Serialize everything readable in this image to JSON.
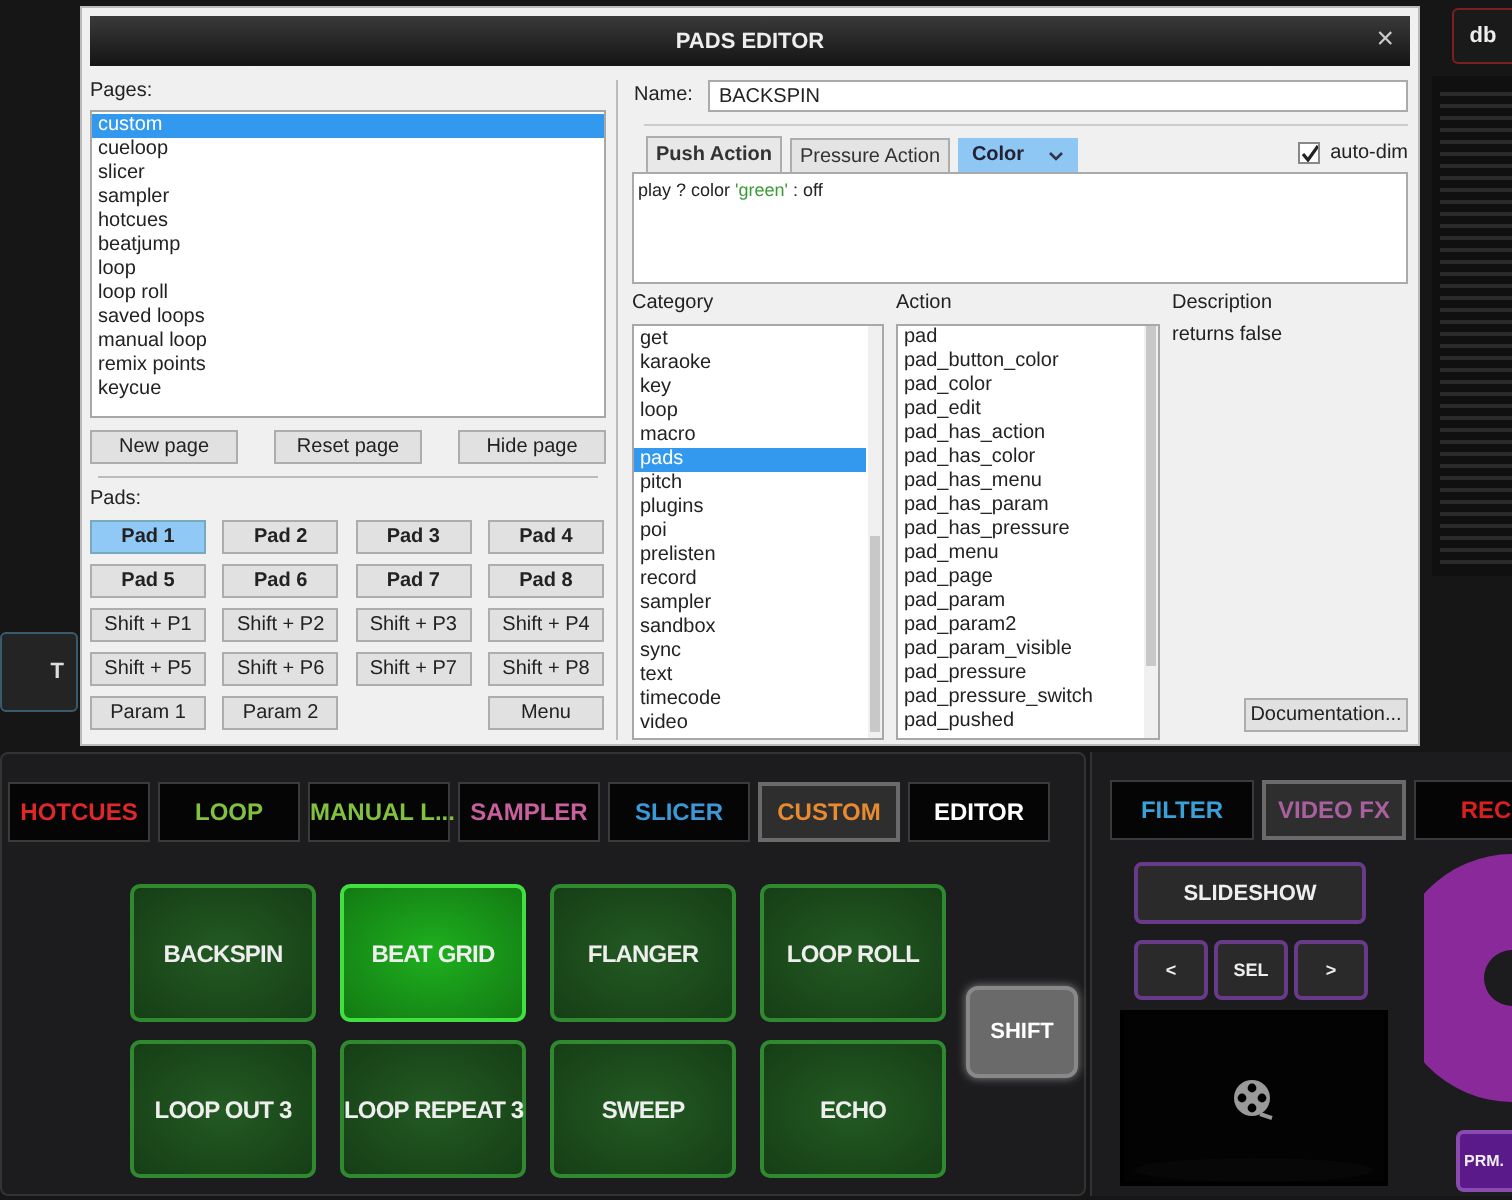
{
  "background": {
    "side_button": "T",
    "level_button": "db"
  },
  "dialog": {
    "title": "PADS EDITOR",
    "close": "×",
    "pages": {
      "label": "Pages:",
      "items": [
        {
          "label": "custom",
          "selected": true
        },
        {
          "label": "cueloop",
          "selected": false
        },
        {
          "label": "slicer",
          "selected": false
        },
        {
          "label": "sampler",
          "selected": false
        },
        {
          "label": "hotcues",
          "selected": false
        },
        {
          "label": "beatjump",
          "selected": false
        },
        {
          "label": "loop",
          "selected": false
        },
        {
          "label": "loop roll",
          "selected": false
        },
        {
          "label": "saved loops",
          "selected": false
        },
        {
          "label": "manual loop",
          "selected": false
        },
        {
          "label": "remix points",
          "selected": false
        },
        {
          "label": "keycue",
          "selected": false
        }
      ]
    },
    "page_buttons": [
      "New page",
      "Reset page",
      "Hide page"
    ],
    "pads": {
      "label": "Pads:",
      "pad_buttons": [
        {
          "label": "Pad 1",
          "selected": true
        },
        {
          "label": "Pad 2",
          "selected": false
        },
        {
          "label": "Pad 3",
          "selected": false
        },
        {
          "label": "Pad 4",
          "selected": false
        },
        {
          "label": "Pad 5",
          "selected": false
        },
        {
          "label": "Pad 6",
          "selected": false
        },
        {
          "label": "Pad 7",
          "selected": false
        },
        {
          "label": "Pad 8",
          "selected": false
        }
      ],
      "shift_buttons": [
        {
          "label": "Shift + P1",
          "selected": false
        },
        {
          "label": "Shift + P2",
          "selected": false
        },
        {
          "label": "Shift + P3",
          "selected": false
        },
        {
          "label": "Shift + P4",
          "selected": false
        },
        {
          "label": "Shift + P5",
          "selected": false
        },
        {
          "label": "Shift + P6",
          "selected": false
        },
        {
          "label": "Shift + P7",
          "selected": false
        },
        {
          "label": "Shift + P8",
          "selected": false
        }
      ],
      "param_buttons": [
        {
          "label": "Param 1",
          "selected": false
        },
        {
          "label": "Param 2",
          "selected": false
        }
      ],
      "menu_button": "Menu"
    },
    "name": {
      "label": "Name:",
      "value": "BACKSPIN"
    },
    "action_tabs": [
      {
        "label": "Push Action",
        "selected": true
      },
      {
        "label": "Pressure Action",
        "selected": false
      }
    ],
    "color_dropdown": "Color",
    "auto_dim": {
      "label": "auto-dim",
      "checked": true
    },
    "script": [
      {
        "text": "play ? color ",
        "kind": "code"
      },
      {
        "text": "'green'",
        "kind": "string"
      },
      {
        "text": " : off",
        "kind": "code"
      }
    ],
    "category": {
      "label": "Category",
      "items": [
        {
          "label": "get",
          "selected": false
        },
        {
          "label": "karaoke",
          "selected": false
        },
        {
          "label": "key",
          "selected": false
        },
        {
          "label": "loop",
          "selected": false
        },
        {
          "label": "macro",
          "selected": false
        },
        {
          "label": "pads",
          "selected": true
        },
        {
          "label": "pitch",
          "selected": false
        },
        {
          "label": "plugins",
          "selected": false
        },
        {
          "label": "poi",
          "selected": false
        },
        {
          "label": "prelisten",
          "selected": false
        },
        {
          "label": "record",
          "selected": false
        },
        {
          "label": "sampler",
          "selected": false
        },
        {
          "label": "sandbox",
          "selected": false
        },
        {
          "label": "sync",
          "selected": false
        },
        {
          "label": "text",
          "selected": false
        },
        {
          "label": "timecode",
          "selected": false
        },
        {
          "label": "video",
          "selected": false
        }
      ]
    },
    "action": {
      "label": "Action",
      "items": [
        {
          "label": "pad",
          "selected": false
        },
        {
          "label": "pad_button_color",
          "selected": false
        },
        {
          "label": "pad_color",
          "selected": false
        },
        {
          "label": "pad_edit",
          "selected": false
        },
        {
          "label": "pad_has_action",
          "selected": false
        },
        {
          "label": "pad_has_color",
          "selected": false
        },
        {
          "label": "pad_has_menu",
          "selected": false
        },
        {
          "label": "pad_has_param",
          "selected": false
        },
        {
          "label": "pad_has_pressure",
          "selected": false
        },
        {
          "label": "pad_menu",
          "selected": false
        },
        {
          "label": "pad_page",
          "selected": false
        },
        {
          "label": "pad_param",
          "selected": false
        },
        {
          "label": "pad_param2",
          "selected": false
        },
        {
          "label": "pad_param_visible",
          "selected": false
        },
        {
          "label": "pad_pressure",
          "selected": false
        },
        {
          "label": "pad_pressure_switch",
          "selected": false
        },
        {
          "label": "pad_pushed",
          "selected": false
        }
      ]
    },
    "description": {
      "label": "Description",
      "text": "returns false"
    },
    "documentation_button": "Documentation..."
  },
  "deck": {
    "tabs": [
      {
        "label": "HOTCUES",
        "color": "#e02828",
        "selected": false
      },
      {
        "label": "LOOP",
        "color": "#82c040",
        "selected": false
      },
      {
        "label": "MANUAL L...",
        "color": "#82c040",
        "selected": false
      },
      {
        "label": "SAMPLER",
        "color": "#c8609e",
        "selected": false
      },
      {
        "label": "SLICER",
        "color": "#3a9ad8",
        "selected": false
      },
      {
        "label": "CUSTOM",
        "color": "#e88a30",
        "selected": true
      },
      {
        "label": "EDITOR",
        "color": "#ffffff",
        "selected": false
      }
    ],
    "pads": [
      {
        "label": "BACKSPIN",
        "lit": false
      },
      {
        "label": "BEAT GRID",
        "lit": true
      },
      {
        "label": "FLANGER",
        "lit": false
      },
      {
        "label": "LOOP ROLL",
        "lit": false
      },
      {
        "label": "LOOP OUT 3",
        "lit": false
      },
      {
        "label": "LOOP REPEAT 3",
        "lit": false
      },
      {
        "label": "SWEEP",
        "lit": false
      },
      {
        "label": "ECHO",
        "lit": false
      }
    ],
    "shift": "SHIFT"
  },
  "video": {
    "tabs": [
      {
        "label": "FILTER",
        "color": "#3aa0d8",
        "selected": false
      },
      {
        "label": "VIDEO FX",
        "color": "#a8609e",
        "selected": true
      },
      {
        "label": "REC",
        "color": "#d82020",
        "selected": false
      }
    ],
    "slideshow": "SLIDESHOW",
    "nav": [
      "<",
      "SEL",
      ">"
    ],
    "param_button": "PRM."
  }
}
